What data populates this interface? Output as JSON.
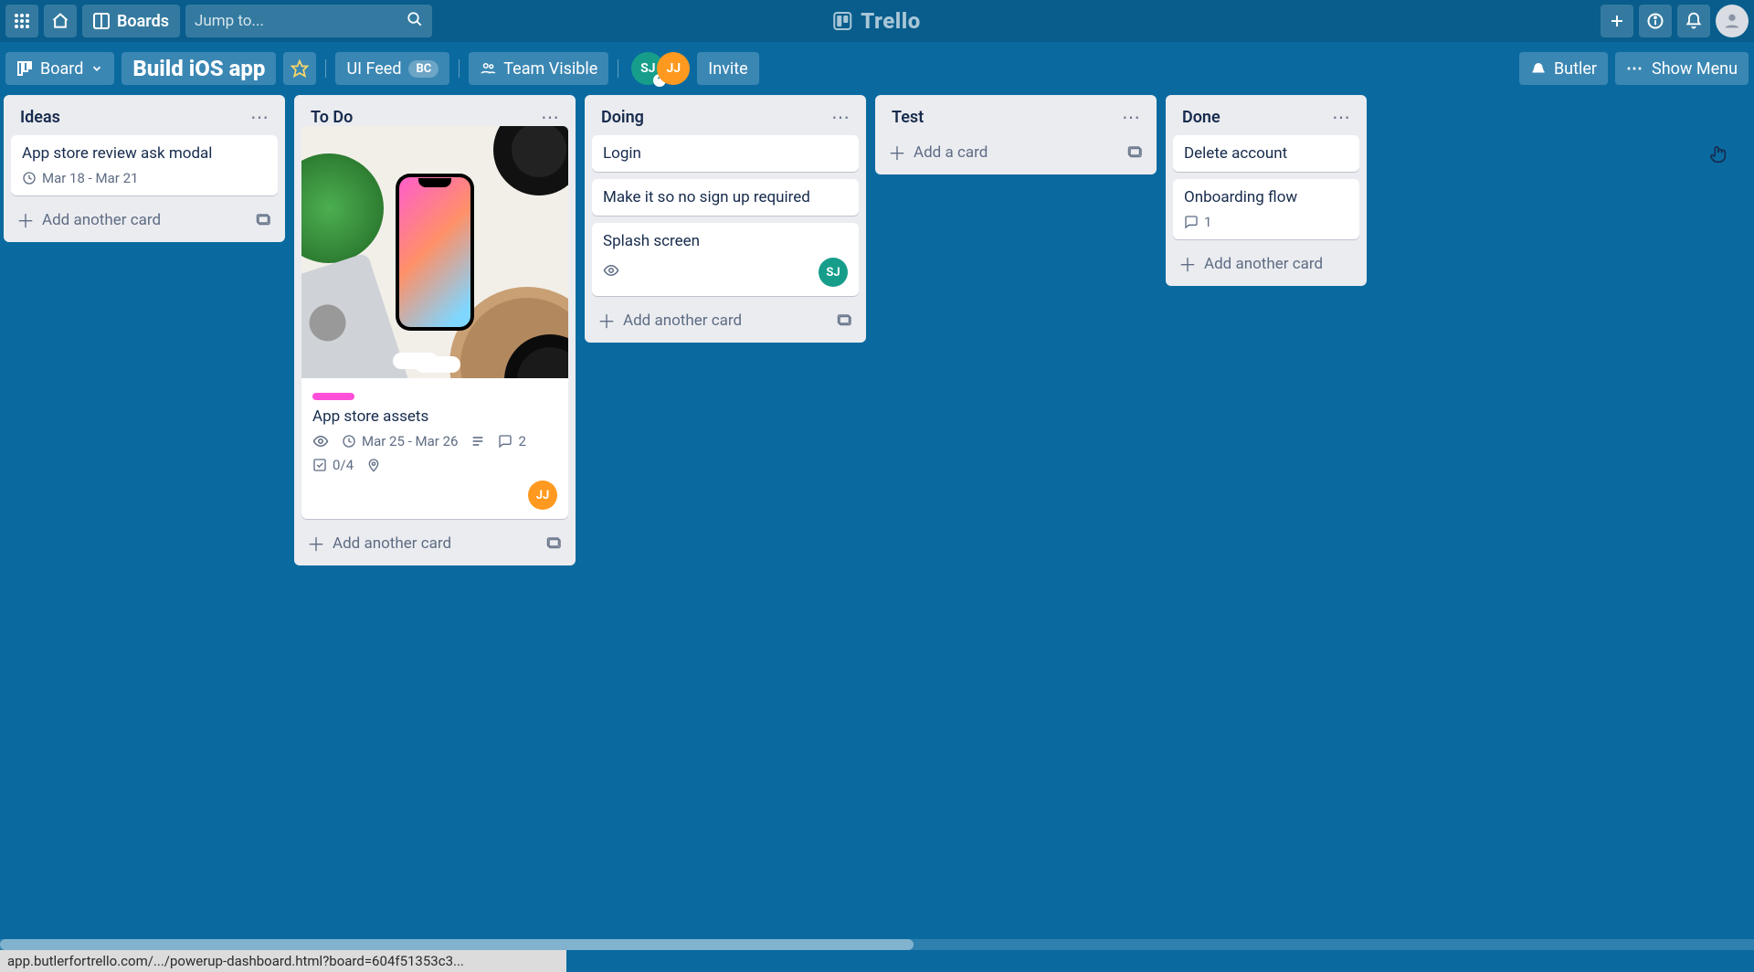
{
  "nav": {
    "boards_label": "Boards",
    "search_placeholder": "Jump to...",
    "brand": "Trello"
  },
  "boardbar": {
    "view_label": "Board",
    "board_title": "Build iOS app",
    "uifeed_label": "UI Feed",
    "uifeed_pill": "BC",
    "visibility_label": "Team Visible",
    "invite_label": "Invite",
    "butler_label": "Butler",
    "showmenu_label": "Show Menu",
    "members": [
      {
        "initials": "SJ",
        "color": "sj"
      },
      {
        "initials": "JJ",
        "color": "jj"
      }
    ]
  },
  "lists": {
    "0": {
      "title": "Ideas",
      "add_label": "Add another card",
      "cards": {
        "0": {
          "title": "App store review ask modal",
          "date": "Mar 18 - Mar 21"
        }
      }
    },
    "1": {
      "title": "To Do",
      "add_label": "Add another card",
      "cards": {
        "0": {
          "title": "App store assets",
          "date": "Mar 25 - Mar 26",
          "comments": "2",
          "checklist": "0/4",
          "member": "JJ"
        }
      }
    },
    "2": {
      "title": "Doing",
      "add_label": "Add another card",
      "cards": {
        "0": {
          "title": "Login"
        },
        "1": {
          "title": "Make it so no sign up required"
        },
        "2": {
          "title": "Splash screen",
          "member": "SJ"
        }
      }
    },
    "3": {
      "title": "Test",
      "add_label": "Add a card"
    },
    "4": {
      "title": "Done",
      "add_label": "Add another card",
      "cards": {
        "0": {
          "title": "Delete account"
        },
        "1": {
          "title": "Onboarding flow",
          "comments": "1"
        }
      }
    }
  },
  "status": "app.butlerfortrello.com/.../powerup-dashboard.html?board=604f51353c3..."
}
